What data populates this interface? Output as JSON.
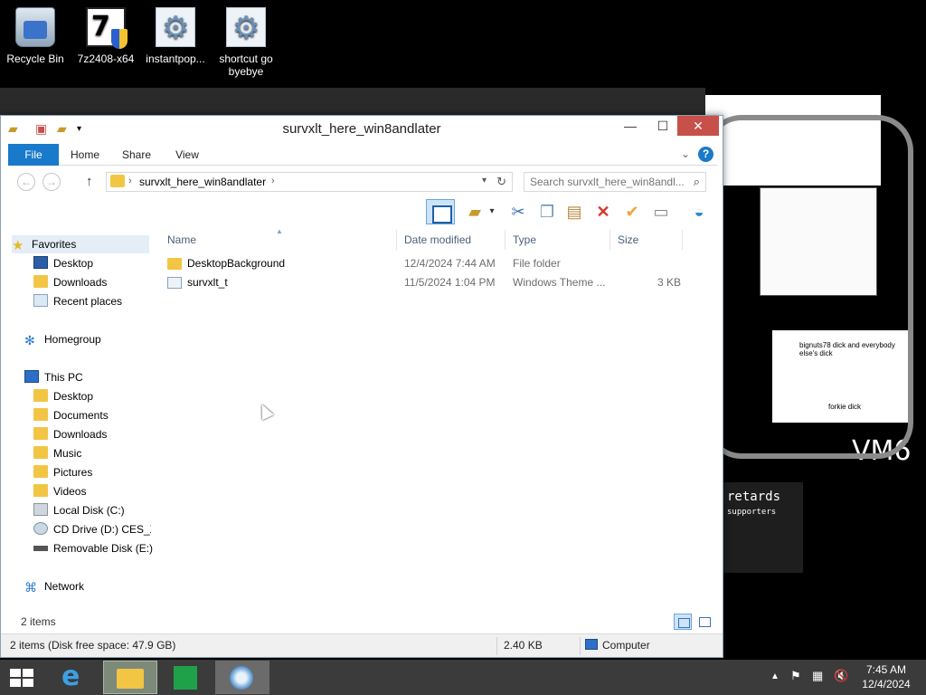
{
  "desktop": {
    "icons": [
      {
        "label": "Recycle Bin",
        "icon": "recycle-bin-icon"
      },
      {
        "label": "7z2408-x64",
        "icon": "7zip-installer-icon"
      },
      {
        "label": "instantpop...",
        "icon": "gear-installer-icon"
      },
      {
        "label": "shortcut go byebye",
        "icon": "gear-installer-icon"
      }
    ],
    "wallpaper_text": {
      "banner": "retards",
      "sub": "supporters",
      "note1": "bignuts78 dick and everybody else's dick",
      "note2": "forkie dick",
      "vm_label": "VM6"
    }
  },
  "window": {
    "title": "survxlt_here_win8andlater",
    "controls": {
      "minimize": "—",
      "maximize": "☐",
      "close": "✕"
    },
    "ribbon_tabs": [
      "File",
      "Home",
      "Share",
      "View"
    ],
    "help": "?",
    "address": {
      "path": "survxlt_here_win8andlater"
    },
    "search": {
      "placeholder": "Search survxlt_here_win8andl..."
    },
    "navigation": {
      "favorites": {
        "label": "Favorites",
        "items": [
          "Desktop",
          "Downloads",
          "Recent places"
        ]
      },
      "homegroup": "Homegroup",
      "this_pc": {
        "label": "This PC",
        "items": [
          "Desktop",
          "Documents",
          "Downloads",
          "Music",
          "Pictures",
          "Videos",
          "Local Disk (C:)",
          "CD Drive (D:) CES_X(",
          "Removable Disk (E:)"
        ]
      },
      "network": "Network"
    },
    "columns": {
      "name": "Name",
      "date": "Date modified",
      "type": "Type",
      "size": "Size"
    },
    "files": [
      {
        "name": "DesktopBackground",
        "date": "12/4/2024 7:44 AM",
        "type": "File folder",
        "size": "",
        "icon": "folder-icon"
      },
      {
        "name": "survxlt_t",
        "date": "11/5/2024 1:04 PM",
        "type": "Windows Theme ...",
        "size": "3 KB",
        "icon": "theme-file-icon"
      }
    ],
    "status": {
      "item_count": "2 items"
    },
    "details": {
      "summary": "2 items (Disk free space: 47.9 GB)",
      "size": "2.40 KB",
      "location": "Computer"
    }
  },
  "taskbar": {
    "clock_time": "7:45 AM",
    "clock_date": "12/4/2024"
  },
  "colors": {
    "accent": "#1979ca",
    "close": "#c7504a",
    "taskbar": "#3b3b3b"
  }
}
